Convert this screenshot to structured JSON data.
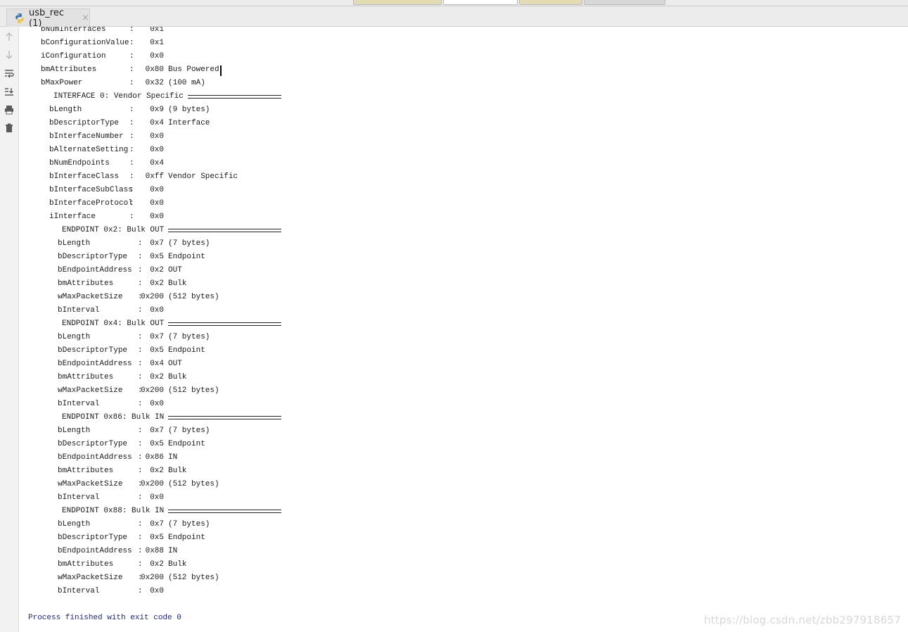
{
  "tool_window": {
    "tab_label": "usb_rec (1)",
    "close_glyph": "×",
    "tab_icon": "python-icon"
  },
  "toolbar": {
    "buttons": [
      {
        "icon": "arrow-up-icon"
      },
      {
        "icon": "arrow-down-icon"
      },
      {
        "icon": "soft-wrap-icon"
      },
      {
        "icon": "scroll-to-end-icon"
      },
      {
        "icon": "print-icon"
      },
      {
        "icon": "trash-icon"
      }
    ]
  },
  "console": {
    "lines": [
      {
        "indent": 0,
        "name": "bNumInterfaces",
        "value": "0x1",
        "desc": ""
      },
      {
        "indent": 0,
        "name": "bConfigurationValue",
        "value": "0x1",
        "desc": ""
      },
      {
        "indent": 0,
        "name": "iConfiguration",
        "value": "0x0",
        "desc": ""
      },
      {
        "indent": 0,
        "name": "bmAttributes",
        "value": "0x80",
        "desc": "Bus Powered",
        "cursor": true
      },
      {
        "indent": 0,
        "name": "bMaxPower",
        "value": "0x32",
        "desc": "(100 mA)"
      },
      {
        "header": true,
        "indent": 1,
        "text": "INTERFACE 0: Vendor Specific"
      },
      {
        "indent": 1,
        "name": "bLength",
        "value": "0x9",
        "desc": "(9 bytes)"
      },
      {
        "indent": 1,
        "name": "bDescriptorType",
        "value": "0x4",
        "desc": "Interface"
      },
      {
        "indent": 1,
        "name": "bInterfaceNumber",
        "value": "0x0",
        "desc": ""
      },
      {
        "indent": 1,
        "name": "bAlternateSetting",
        "value": "0x0",
        "desc": ""
      },
      {
        "indent": 1,
        "name": "bNumEndpoints",
        "value": "0x4",
        "desc": ""
      },
      {
        "indent": 1,
        "name": "bInterfaceClass",
        "value": "0xff",
        "desc": "Vendor Specific"
      },
      {
        "indent": 1,
        "name": "bInterfaceSubClass",
        "value": "0x0",
        "desc": ""
      },
      {
        "indent": 1,
        "name": "bInterfaceProtocol",
        "value": "0x0",
        "desc": ""
      },
      {
        "indent": 1,
        "name": "iInterface",
        "value": "0x0",
        "desc": ""
      },
      {
        "header": true,
        "indent": 2,
        "text": "ENDPOINT 0x2: Bulk OUT"
      },
      {
        "indent": 2,
        "name": "bLength",
        "value": "0x7",
        "desc": "(7 bytes)"
      },
      {
        "indent": 2,
        "name": "bDescriptorType",
        "value": "0x5",
        "desc": "Endpoint"
      },
      {
        "indent": 2,
        "name": "bEndpointAddress",
        "value": "0x2",
        "desc": "OUT"
      },
      {
        "indent": 2,
        "name": "bmAttributes",
        "value": "0x2",
        "desc": "Bulk"
      },
      {
        "indent": 2,
        "name": "wMaxPacketSize",
        "value": "0x200",
        "desc": "(512 bytes)"
      },
      {
        "indent": 2,
        "name": "bInterval",
        "value": "0x0",
        "desc": ""
      },
      {
        "header": true,
        "indent": 2,
        "text": "ENDPOINT 0x4: Bulk OUT"
      },
      {
        "indent": 2,
        "name": "bLength",
        "value": "0x7",
        "desc": "(7 bytes)"
      },
      {
        "indent": 2,
        "name": "bDescriptorType",
        "value": "0x5",
        "desc": "Endpoint"
      },
      {
        "indent": 2,
        "name": "bEndpointAddress",
        "value": "0x4",
        "desc": "OUT"
      },
      {
        "indent": 2,
        "name": "bmAttributes",
        "value": "0x2",
        "desc": "Bulk"
      },
      {
        "indent": 2,
        "name": "wMaxPacketSize",
        "value": "0x200",
        "desc": "(512 bytes)"
      },
      {
        "indent": 2,
        "name": "bInterval",
        "value": "0x0",
        "desc": ""
      },
      {
        "header": true,
        "indent": 2,
        "text": "ENDPOINT 0x86: Bulk IN"
      },
      {
        "indent": 2,
        "name": "bLength",
        "value": "0x7",
        "desc": "(7 bytes)"
      },
      {
        "indent": 2,
        "name": "bDescriptorType",
        "value": "0x5",
        "desc": "Endpoint"
      },
      {
        "indent": 2,
        "name": "bEndpointAddress",
        "value": "0x86",
        "desc": "IN"
      },
      {
        "indent": 2,
        "name": "bmAttributes",
        "value": "0x2",
        "desc": "Bulk"
      },
      {
        "indent": 2,
        "name": "wMaxPacketSize",
        "value": "0x200",
        "desc": "(512 bytes)"
      },
      {
        "indent": 2,
        "name": "bInterval",
        "value": "0x0",
        "desc": ""
      },
      {
        "header": true,
        "indent": 2,
        "text": "ENDPOINT 0x88: Bulk IN"
      },
      {
        "indent": 2,
        "name": "bLength",
        "value": "0x7",
        "desc": "(7 bytes)"
      },
      {
        "indent": 2,
        "name": "bDescriptorType",
        "value": "0x5",
        "desc": "Endpoint"
      },
      {
        "indent": 2,
        "name": "bEndpointAddress",
        "value": "0x88",
        "desc": "IN"
      },
      {
        "indent": 2,
        "name": "bmAttributes",
        "value": "0x2",
        "desc": "Bulk"
      },
      {
        "indent": 2,
        "name": "wMaxPacketSize",
        "value": "0x200",
        "desc": "(512 bytes)"
      },
      {
        "indent": 2,
        "name": "bInterval",
        "value": "0x0",
        "desc": ""
      }
    ],
    "exit_message": "Process finished with exit code 0"
  },
  "colors": {
    "exit_text": "#1b2a8a",
    "console_text": "#1a1a1a",
    "watermark": "#d8d8d8"
  },
  "watermark": "https://blog.csdn.net/zbb297918657"
}
